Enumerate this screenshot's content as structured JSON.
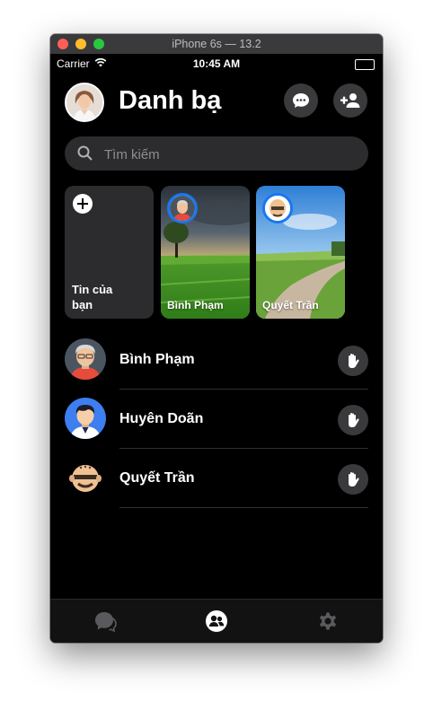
{
  "window": {
    "title": "iPhone 6s — 13.2"
  },
  "status_bar": {
    "carrier": "Carrier",
    "time": "10:45 AM",
    "wifi_icon": "wifi-icon",
    "battery_level": 1.0
  },
  "header": {
    "title": "Danh bạ",
    "avatar_icon": "user-avatar",
    "chat_button_icon": "chat-bubble-icon",
    "add_contact_button_icon": "add-person-icon"
  },
  "search": {
    "placeholder": "Tìm kiếm",
    "value": "",
    "icon": "search-icon"
  },
  "stories": [
    {
      "label": "Tin của bạn",
      "icon": "plus-icon",
      "own": true
    },
    {
      "name": "Bình Phạm",
      "background": "green-field"
    },
    {
      "name": "Quyết Trần",
      "background": "country-road"
    }
  ],
  "contacts": [
    {
      "name": "Bình Phạm",
      "action_icon": "wave-hand-icon"
    },
    {
      "name": "Huyên Doãn",
      "action_icon": "wave-hand-icon"
    },
    {
      "name": "Quyết Trần",
      "action_icon": "wave-hand-icon"
    }
  ],
  "tab_bar": {
    "tabs": [
      {
        "icon": "chats-icon",
        "active": false
      },
      {
        "icon": "people-icon",
        "active": true
      },
      {
        "icon": "settings-gear-icon",
        "active": false
      }
    ]
  },
  "colors": {
    "accent": "#1877f2",
    "background": "#000000",
    "surface": "#2c2c2e",
    "button": "#3a3a3c"
  }
}
